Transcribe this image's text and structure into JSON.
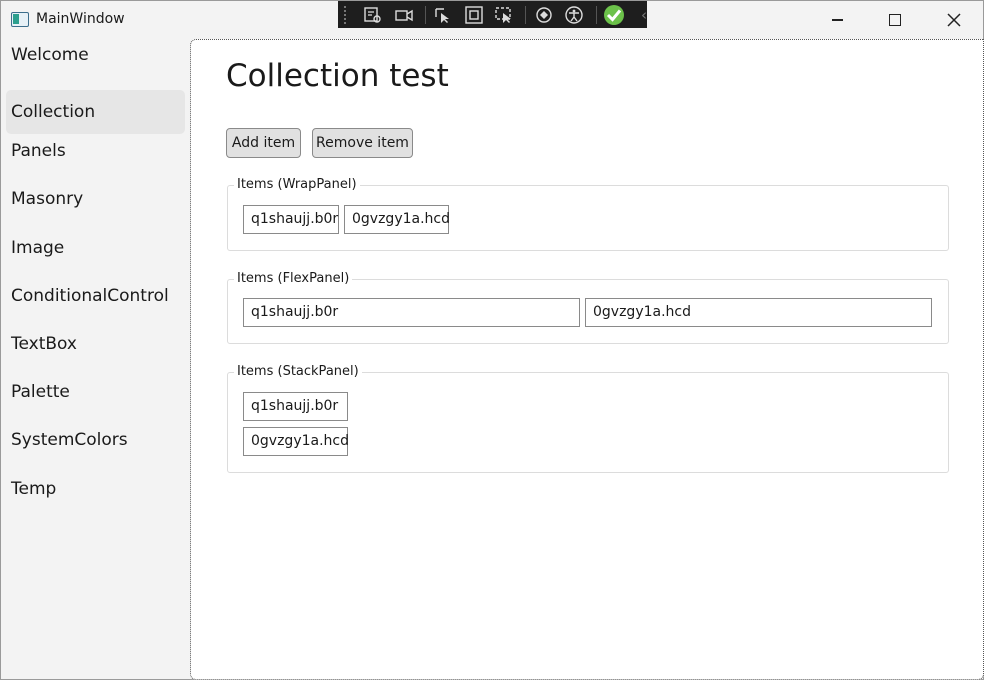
{
  "window": {
    "title": "MainWindow"
  },
  "debug_toolbar": {
    "icons": [
      "select-element-icon",
      "record-icon",
      "pointer-select-icon",
      "display-layout-adorners-icon",
      "track-focus-icon",
      "hot-reload-icon",
      "accessibility-icon",
      "check-icon",
      "chevron-left-icon"
    ]
  },
  "sidebar": {
    "items": [
      {
        "label": "Welcome"
      },
      {
        "label": "Collection"
      },
      {
        "label": "Panels"
      },
      {
        "label": "Masonry"
      },
      {
        "label": "Image"
      },
      {
        "label": "ConditionalControl"
      },
      {
        "label": "TextBox"
      },
      {
        "label": "Palette"
      },
      {
        "label": "SystemColors"
      },
      {
        "label": "Temp"
      }
    ],
    "selected_index": 1
  },
  "main": {
    "title": "Collection test",
    "add_label": "Add item",
    "remove_label": "Remove item",
    "groups": [
      {
        "legend": "Items (WrapPanel)",
        "items": [
          "q1shaujj.b0r",
          "0gvzgy1a.hcd"
        ]
      },
      {
        "legend": "Items (FlexPanel)",
        "items": [
          "q1shaujj.b0r",
          "0gvzgy1a.hcd"
        ]
      },
      {
        "legend": "Items (StackPanel)",
        "items": [
          "q1shaujj.b0r",
          "0gvzgy1a.hcd"
        ]
      }
    ]
  },
  "colors": {
    "toolbar_bg": "#1e1e1e",
    "selected_nav_bg": "#e6e6e6",
    "check_green": "#6cc24a"
  }
}
